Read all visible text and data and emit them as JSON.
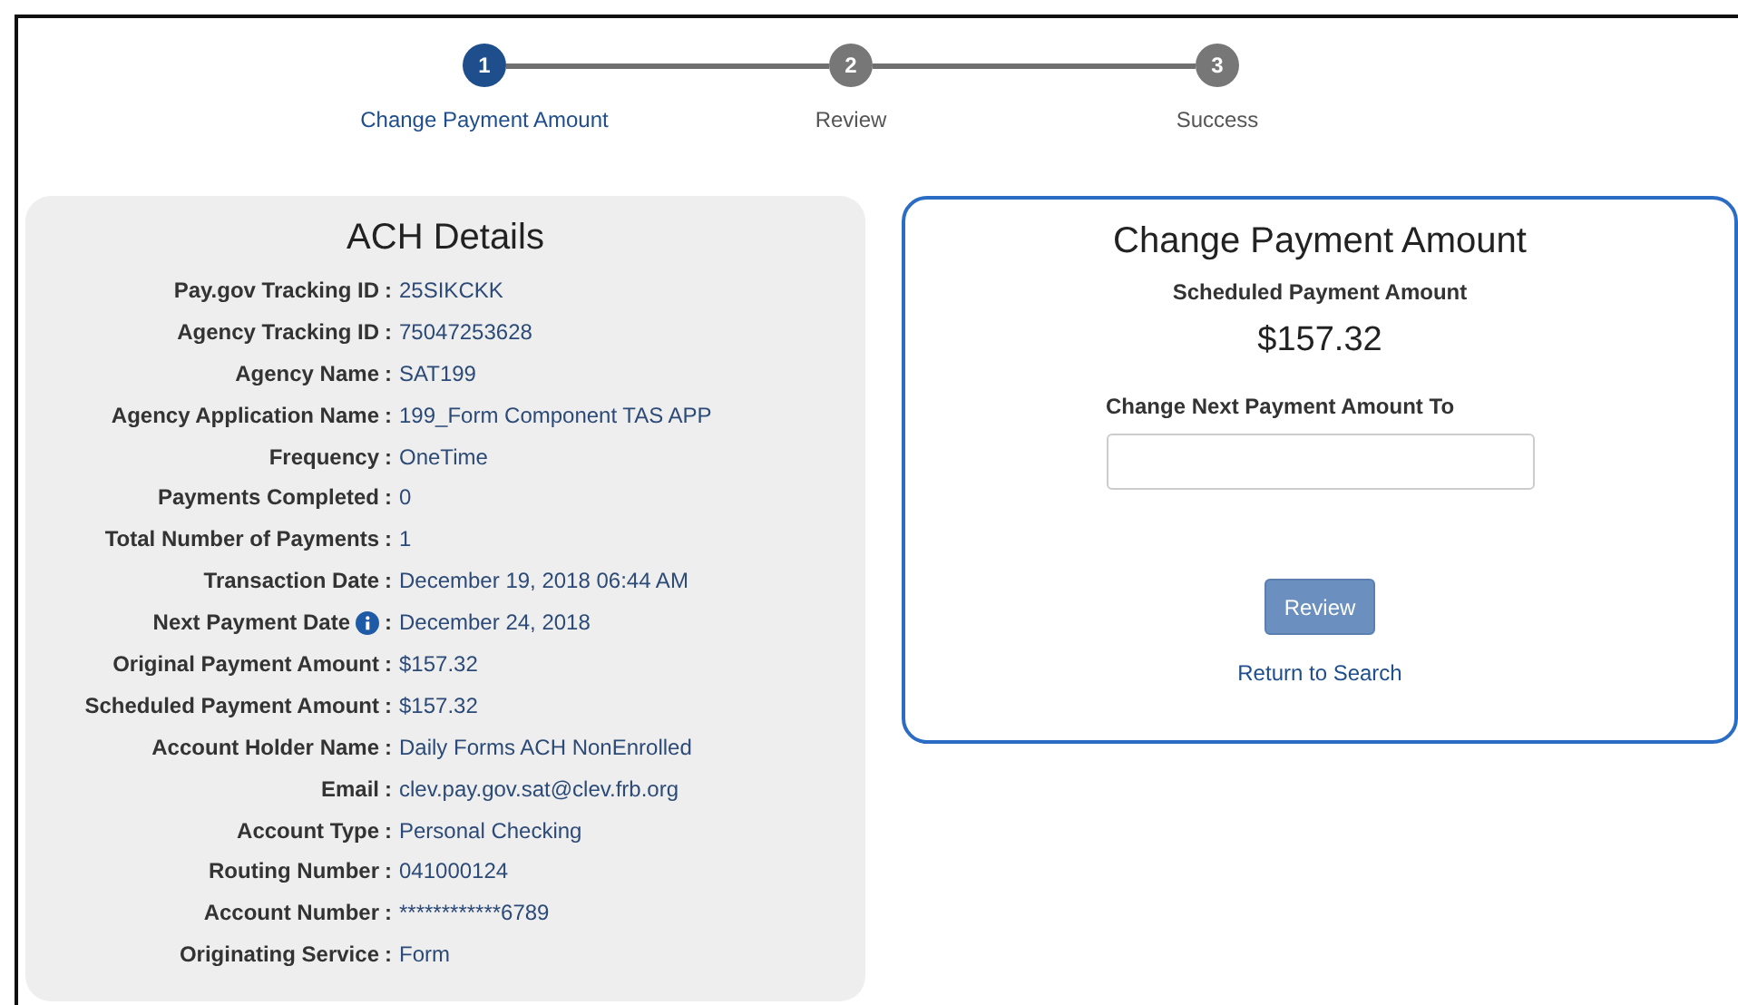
{
  "steps": [
    {
      "number": "1",
      "label": "Change Payment Amount",
      "selected": true
    },
    {
      "number": "2",
      "label": "Review",
      "selected": false
    },
    {
      "number": "3",
      "label": "Success",
      "selected": false
    }
  ],
  "details": {
    "title": "ACH Details",
    "rows": [
      {
        "label": "Pay.gov Tracking ID",
        "separator": ":",
        "value": "25SIKCKK",
        "info": false
      },
      {
        "label": "Agency Tracking ID",
        "separator": ":",
        "value": "75047253628",
        "info": false
      },
      {
        "label": "Agency Name",
        "separator": ":",
        "value": "SAT199",
        "info": false
      },
      {
        "label": "Agency Application Name",
        "separator": ":",
        "value": "199_Form Component TAS APP",
        "info": false
      },
      {
        "label": "Frequency",
        "separator": ":",
        "value": "OneTime",
        "info": false
      },
      {
        "label": "Payments Completed",
        "separator": ":",
        "value": "0",
        "info": false
      },
      {
        "label": "Total Number of Payments",
        "separator": ":",
        "value": "1",
        "info": false
      },
      {
        "label": "Transaction Date",
        "separator": ":",
        "value": "December 19, 2018 06:44 AM",
        "info": false
      },
      {
        "label": "Next Payment Date",
        "separator": ":",
        "value": "December 24, 2018",
        "info": true
      },
      {
        "label": "Original Payment Amount",
        "separator": ":",
        "value": "$157.32",
        "info": false
      },
      {
        "label": "Scheduled Payment Amount",
        "separator": ":",
        "value": "$157.32",
        "info": false
      },
      {
        "label": "Account Holder Name",
        "separator": ":",
        "value": "Daily Forms ACH NonEnrolled",
        "info": false
      },
      {
        "label": "Email",
        "separator": ":",
        "value": "clev.pay.gov.sat@clev.frb.org",
        "info": false
      },
      {
        "label": "Account Type",
        "separator": ":",
        "value": "Personal Checking",
        "info": false
      },
      {
        "label": "Routing Number",
        "separator": ":",
        "value": "041000124",
        "info": false
      },
      {
        "label": "Account Number",
        "separator": ":",
        "value": "************6789",
        "info": false
      },
      {
        "label": "Originating Service",
        "separator": ":",
        "value": "Form",
        "info": false
      }
    ]
  },
  "change": {
    "title": "Change Payment Amount",
    "scheduled_label": "Scheduled Payment Amount",
    "scheduled_amount": "$157.32",
    "field_label": "Change Next Payment Amount To",
    "review_button": "Review",
    "return_link": "Return to Search"
  }
}
